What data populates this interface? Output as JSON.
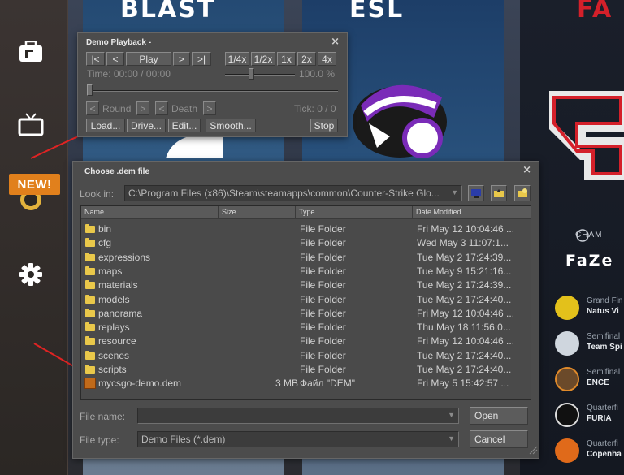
{
  "background": {
    "badge": "NEW!",
    "brands": [
      "BLAST",
      "ESL",
      "FA"
    ],
    "event": {
      "champ_label": "CHAM",
      "champion": "FaZe",
      "matches": [
        {
          "round": "Grand Fin",
          "team": "Natus Vi"
        },
        {
          "round": "Semifinal",
          "team": "Team Spi"
        },
        {
          "round": "Semifinal",
          "team": "ENCE"
        },
        {
          "round": "Quarterfi",
          "team": "FURIA"
        },
        {
          "round": "Quarterfi",
          "team": "Copenha"
        }
      ]
    },
    "colors": {
      "accent_orange": "#e1801c",
      "arrow_red": "#e02323"
    }
  },
  "playback": {
    "title": "Demo Playback -",
    "close": "×",
    "transport": {
      "first": "|<",
      "prev": "<",
      "play": "Play",
      "next": ">",
      "last": ">|"
    },
    "speeds": [
      "1/4x",
      "1/2x",
      "1x",
      "2x",
      "4x"
    ],
    "time_label": "Time: 00:00 / 00:00",
    "speed_value": "100.0 %",
    "round_label": "Round",
    "death_label": "Death",
    "nav_prev": "<",
    "nav_next": ">",
    "tick_label": "Tick: 0 / 0",
    "buttons": {
      "load": "Load...",
      "drive": "Drive...",
      "edit": "Edit...",
      "smooth": "Smooth...",
      "stop": "Stop"
    }
  },
  "dialog": {
    "title": "Choose .dem file",
    "close": "×",
    "look_in_label": "Look in:",
    "look_in_value": "C:\\Program Files (x86)\\Steam\\steamapps\\common\\Counter-Strike Glo...",
    "columns": {
      "name": "Name",
      "size": "Size",
      "type": "Type",
      "modified": "Date Modified"
    },
    "files": [
      {
        "name": "bin",
        "size": "",
        "type": "File Folder",
        "modified": "Fri May 12 10:04:46 ...",
        "icon": "folder-icon"
      },
      {
        "name": "cfg",
        "size": "",
        "type": "File Folder",
        "modified": "Wed May  3 11:07:1...",
        "icon": "folder-icon"
      },
      {
        "name": "expressions",
        "size": "",
        "type": "File Folder",
        "modified": "Tue May  2 17:24:39...",
        "icon": "folder-icon"
      },
      {
        "name": "maps",
        "size": "",
        "type": "File Folder",
        "modified": "Tue May  9 15:21:16...",
        "icon": "folder-icon"
      },
      {
        "name": "materials",
        "size": "",
        "type": "File Folder",
        "modified": "Tue May  2 17:24:39...",
        "icon": "folder-icon"
      },
      {
        "name": "models",
        "size": "",
        "type": "File Folder",
        "modified": "Tue May  2 17:24:40...",
        "icon": "folder-icon"
      },
      {
        "name": "panorama",
        "size": "",
        "type": "File Folder",
        "modified": "Fri May 12 10:04:46 ...",
        "icon": "folder-icon"
      },
      {
        "name": "replays",
        "size": "",
        "type": "File Folder",
        "modified": "Thu May 18 11:56:0...",
        "icon": "folder-icon"
      },
      {
        "name": "resource",
        "size": "",
        "type": "File Folder",
        "modified": "Fri May 12 10:04:46 ...",
        "icon": "folder-icon"
      },
      {
        "name": "scenes",
        "size": "",
        "type": "File Folder",
        "modified": "Tue May  2 17:24:40...",
        "icon": "folder-icon"
      },
      {
        "name": "scripts",
        "size": "",
        "type": "File Folder",
        "modified": "Tue May  2 17:24:40...",
        "icon": "folder-icon"
      },
      {
        "name": "mycsgo-demo.dem",
        "size": "3 MB",
        "type": "Файл \"DEM\"",
        "modified": "Fri May  5 15:42:57 ...",
        "icon": "demo-file-icon"
      }
    ],
    "file_name_label": "File name:",
    "file_name_value": "",
    "file_type_label": "File type:",
    "file_type_value": "Demo Files (*.dem)",
    "open": "Open",
    "cancel": "Cancel"
  }
}
